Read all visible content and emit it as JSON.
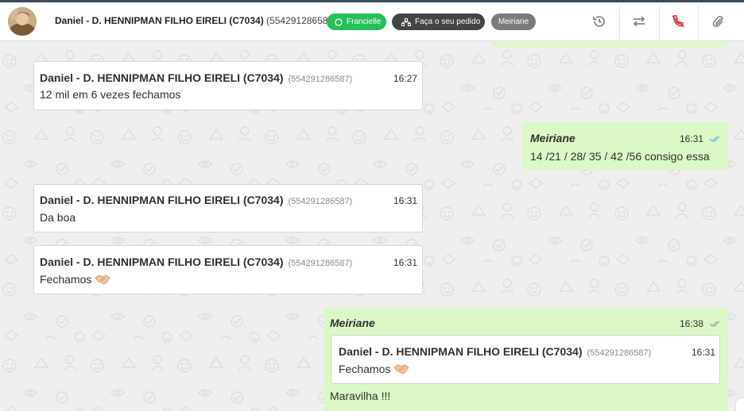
{
  "header": {
    "contact_name": "Daniel - D. HENNIPMAN FILHO EIRELI (C7034)",
    "contact_phone": "(554291286587)",
    "tags": {
      "agent": "Francielle",
      "order": "Faça o seu pedido",
      "user": "Meiriane"
    },
    "icons": [
      "history-icon",
      "transfer-icon",
      "end-call-icon",
      "attach-icon"
    ]
  },
  "messages": [
    {
      "direction": "in",
      "sender": "Daniel - D. HENNIPMAN FILHO EIRELI (C7034)",
      "phone": "(554291286587)",
      "time": "16:27",
      "text": "12 mil em 6 vezes fechamos"
    },
    {
      "direction": "out",
      "sender": "Meiriane",
      "time": "16:31",
      "text": "14 /21 / 28/ 35 / 42 /56 consigo essa",
      "status": "read"
    },
    {
      "direction": "in",
      "sender": "Daniel - D. HENNIPMAN FILHO EIRELI (C7034)",
      "phone": "(554291286587)",
      "time": "16:31",
      "text": "Da boa"
    },
    {
      "direction": "in",
      "sender": "Daniel - D. HENNIPMAN FILHO EIRELI (C7034)",
      "phone": "(554291286587)",
      "time": "16:31",
      "text": "Fechamos",
      "emoji": "handshake-emoji"
    },
    {
      "direction": "out",
      "sender": "Meiriane",
      "time": "16:38",
      "status": "delivered",
      "quoted": {
        "sender": "Daniel - D. HENNIPMAN FILHO EIRELI (C7034)",
        "phone": "(554291286587)",
        "time": "16:31",
        "text": "Fechamos",
        "emoji": "handshake-emoji"
      },
      "text": "Maravilha !!!"
    }
  ],
  "colors": {
    "outgoing_bubble": "#dcf8c6",
    "incoming_bubble": "#ffffff",
    "chat_background": "#efefef",
    "agent_tag": "#25c05a",
    "order_tag": "#444444",
    "user_tag": "#7b7b7b",
    "end_call": "#e0303a",
    "read_tick": "#4fb6ec"
  }
}
